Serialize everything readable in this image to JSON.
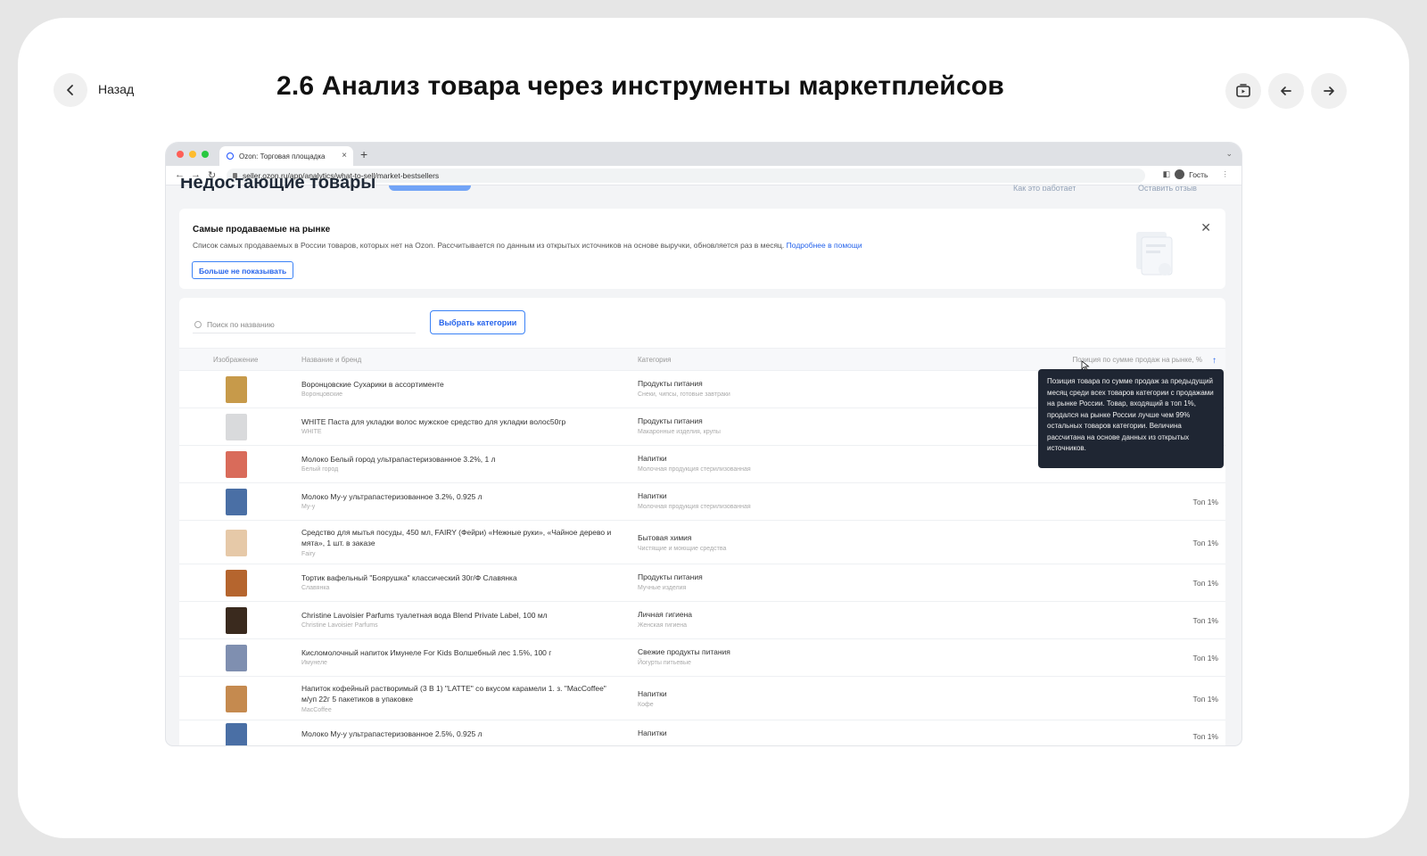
{
  "lesson": {
    "back_label": "Назад",
    "title": "2.6 Анализ товара через инструменты маркетплейсов"
  },
  "browser": {
    "tab_title": "Ozon: Торговая площадка",
    "url": "seller.ozon.ru/app/analytics/what-to-sell/market-bestsellers",
    "profile_label": "Гость"
  },
  "page": {
    "heading": "Недостающие товары",
    "top_link_1": "Как это работает",
    "top_link_2": "Оставить отзыв"
  },
  "banner": {
    "title": "Самые продаваемые на рынке",
    "text": "Список самых продаваемых в России товаров, которых нет на Ozon. Рассчитывается по данным из открытых источников на основе выручки, обновляется раз в месяц.",
    "link": "Подробнее в помощи",
    "dismiss_label": "Больше не показывать"
  },
  "toolbar": {
    "search_placeholder": "Поиск по названию",
    "category_button": "Выбрать категории"
  },
  "table": {
    "columns": [
      "Изображение",
      "Название и бренд",
      "Категория",
      "Позиция по сумме продаж на рынке, %"
    ],
    "rows": [
      {
        "name": "Воронцовские Сухарики в ассортименте",
        "brand": "Воронцовские",
        "category": "Продукты питания",
        "subcategory": "Снеки, чипсы, готовые завтраки",
        "position": "",
        "thumb": "#c79a4a"
      },
      {
        "name": "WHITE Паста для укладки волос мужское средство для укладки волос50гр",
        "brand": "WHITE",
        "category": "Продукты питания",
        "subcategory": "Макаронные изделия, крупы",
        "position": "",
        "thumb": "#d9dadc"
      },
      {
        "name": "Молоко Белый город ультрапастеризованное 3.2%, 1 л",
        "brand": "Белый город",
        "category": "Напитки",
        "subcategory": "Молочная продукция стерилизованная",
        "position": "",
        "thumb": "#d96b5a"
      },
      {
        "name": "Молоко Му-у ультрапастеризованное 3.2%, 0.925 л",
        "brand": "Му-у",
        "category": "Напитки",
        "subcategory": "Молочная продукция стерилизованная",
        "position": "Топ 1%",
        "thumb": "#4a6fa5"
      },
      {
        "name": "Средство для мытья посуды, 450 мл, FAIRY (Фейри) «Нежные руки», «Чайное дерево и мята», 1 шт. в заказе",
        "brand": "Fairy",
        "category": "Бытовая химия",
        "subcategory": "Чистящие и моющие средства",
        "position": "Топ 1%",
        "thumb": "#e6c9a8"
      },
      {
        "name": "Тортик вафельный \"Боярушка\" классический 30г/Ф Славянка",
        "brand": "Славянка",
        "category": "Продукты питания",
        "subcategory": "Мучные изделия",
        "position": "Топ 1%",
        "thumb": "#b5652e"
      },
      {
        "name": "Christine Lavoisier Parfums туалетная вода Blend Private Label, 100 мл",
        "brand": "Christine Lavoisier Parfums",
        "category": "Личная гигиена",
        "subcategory": "Женская гигиена",
        "position": "Топ 1%",
        "thumb": "#3a2a1e"
      },
      {
        "name": "Кисломолочный напиток Имунеле For Kids Волшебный лес 1.5%, 100 г",
        "brand": "Имунеле",
        "category": "Свежие продукты питания",
        "subcategory": "Йогурты питьевые",
        "position": "Топ 1%",
        "thumb": "#7f8fb0"
      },
      {
        "name": "Напиток кофейный растворимый (3 В 1) \"LATTE\" со вкусом карамели 1. з. \"MacCoffee\" м/уп 22г 5 пакетиков в упаковке",
        "brand": "MacCoffee",
        "category": "Напитки",
        "subcategory": "Кофе",
        "position": "Топ 1%",
        "thumb": "#c58a4f"
      },
      {
        "name": "Молоко Му-у ультрапастеризованное 2.5%, 0.925 л",
        "brand": "",
        "category": "Напитки",
        "subcategory": "",
        "position": "Топ 1%",
        "thumb": "#4a6fa5"
      }
    ]
  },
  "tooltip": {
    "text": "Позиция товара по сумме продаж за предыдущий месяц среди всех товаров категории с продажами на рынке России. Товар, входящий в топ 1%, продался на рынке России лучше чем 99% остальных товаров категории. Величина рассчитана на основе данных из открытых источников."
  },
  "colors": {
    "accent": "#2563eb",
    "tooltip_bg": "#1f2633"
  }
}
